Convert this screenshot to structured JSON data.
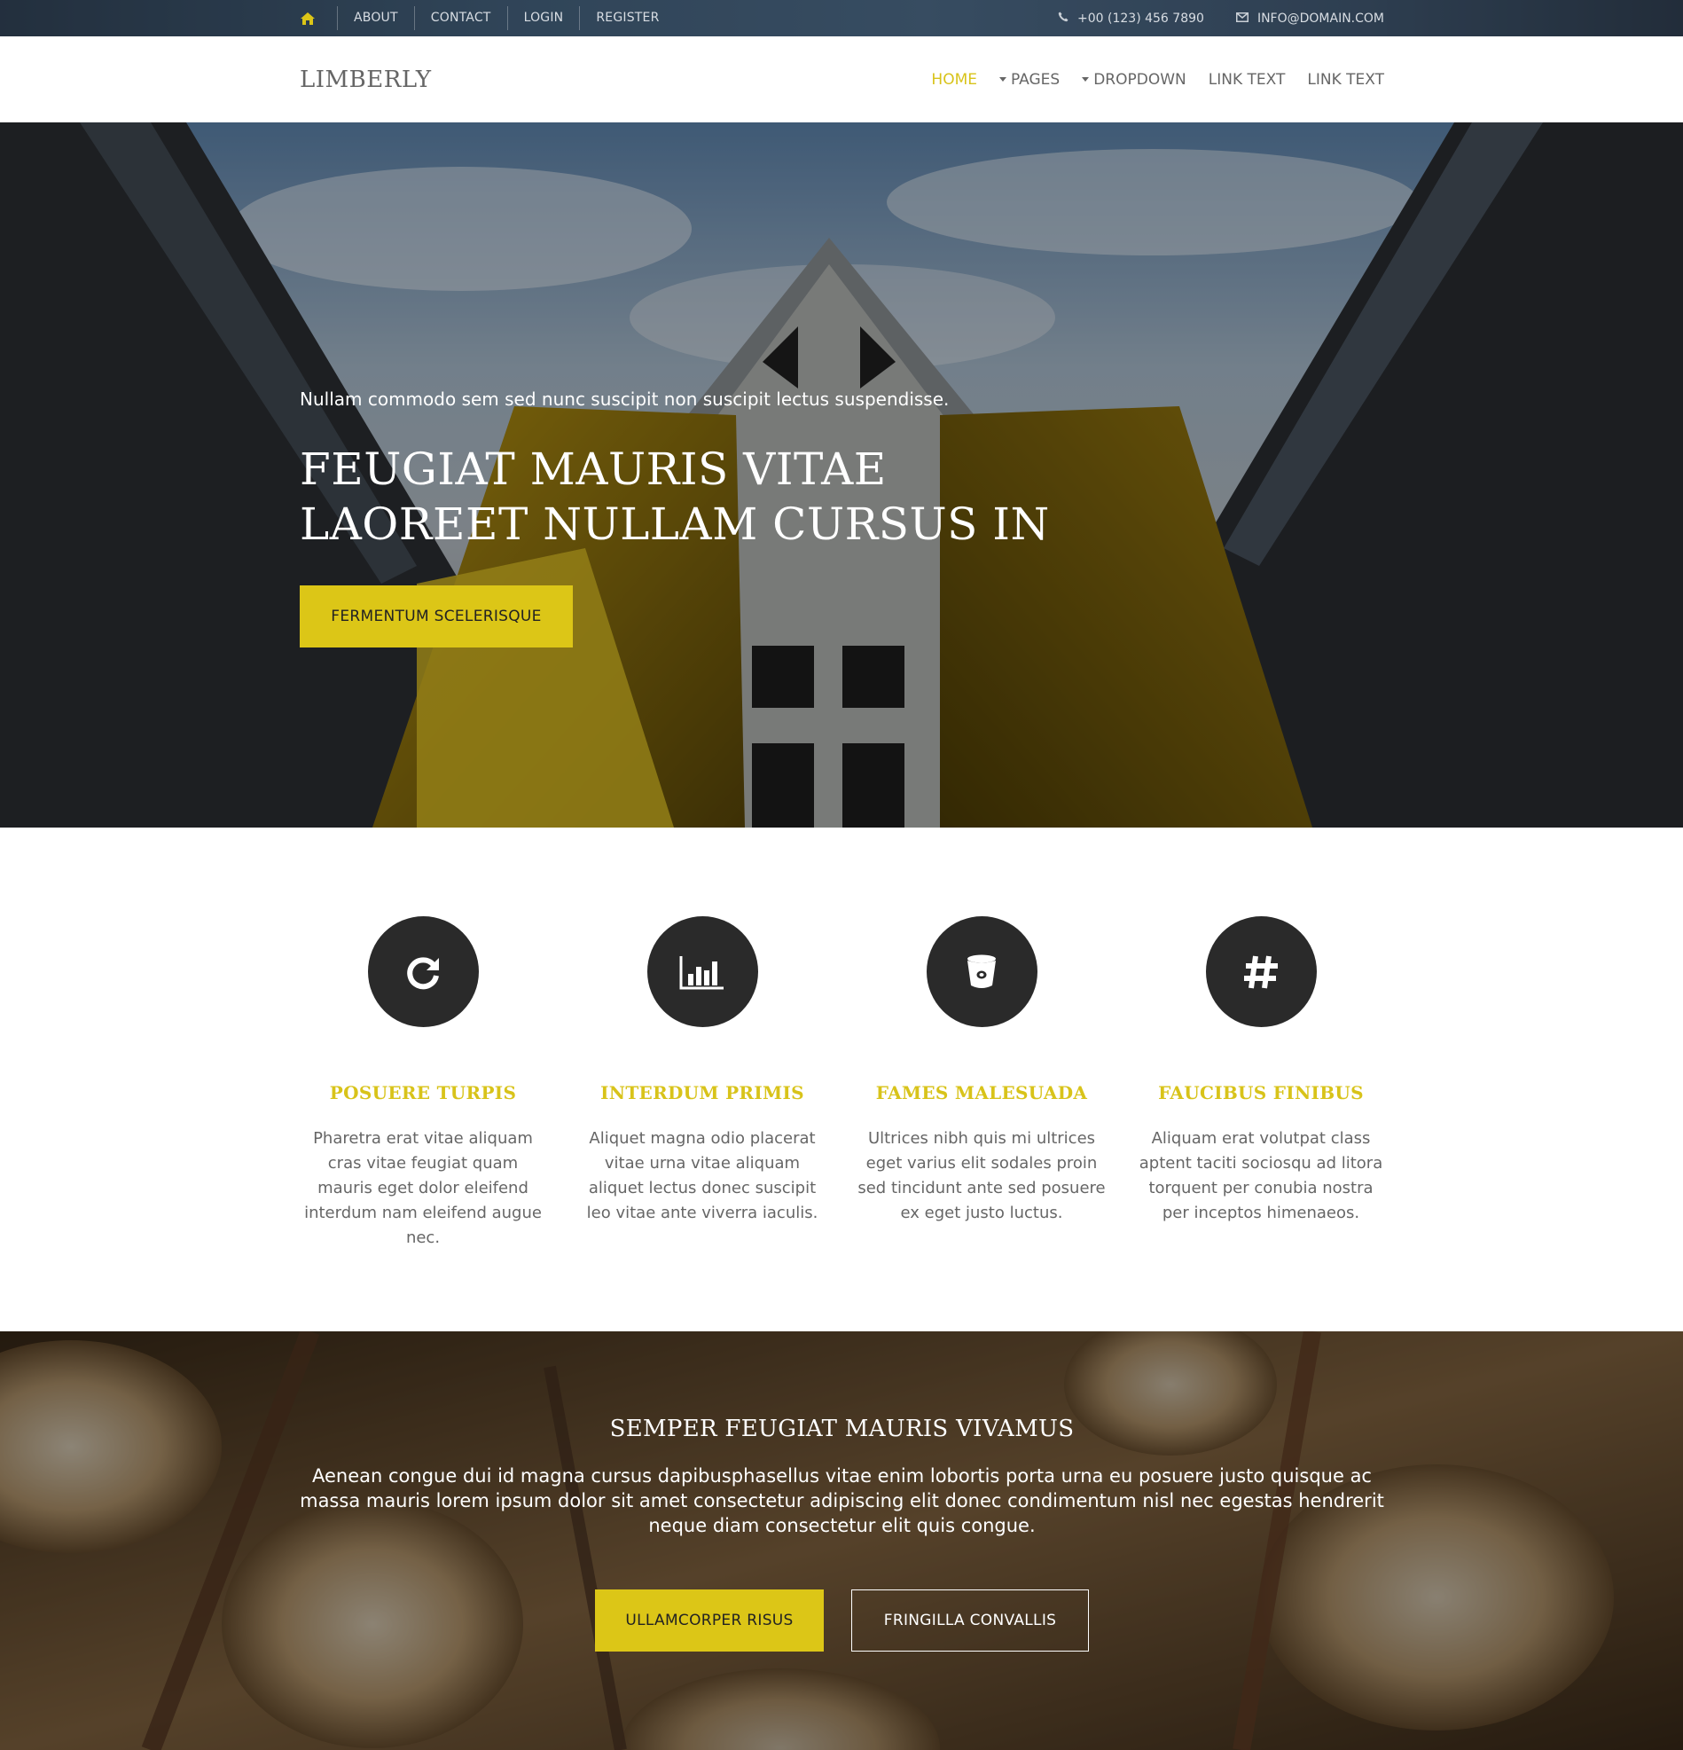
{
  "topbar": {
    "home_icon": "home-icon",
    "links": [
      "ABOUT",
      "CONTACT",
      "LOGIN",
      "REGISTER"
    ],
    "phone_icon": "phone-icon",
    "phone": "+00 (123) 456 7890",
    "email_icon": "envelope-icon",
    "email": "INFO@DOMAIN.COM"
  },
  "navbar": {
    "brand": "LIMBERLY",
    "items": [
      {
        "label": "HOME",
        "active": true,
        "dropdown": false
      },
      {
        "label": "PAGES",
        "active": false,
        "dropdown": true
      },
      {
        "label": "DROPDOWN",
        "active": false,
        "dropdown": true
      },
      {
        "label": "LINK TEXT",
        "active": false,
        "dropdown": false
      },
      {
        "label": "LINK TEXT",
        "active": false,
        "dropdown": false
      }
    ]
  },
  "hero": {
    "lead": "Nullam commodo sem sed nunc suscipit non suscipit lectus suspendisse.",
    "title": "FEUGIAT MAURIS VITAE LAOREET NULLAM CURSUS IN",
    "button": "FERMENTUM SCELERISQUE"
  },
  "features": [
    {
      "icon": "refresh-icon",
      "title": "POSUERE TURPIS",
      "text": "Pharetra erat vitae aliquam cras vitae feugiat quam mauris eget dolor eleifend interdum nam eleifend augue nec."
    },
    {
      "icon": "bar-chart-icon",
      "title": "INTERDUM PRIMIS",
      "text": "Aliquet magna odio placerat vitae urna vitae aliquam aliquet lectus donec suscipit leo vitae ante viverra iaculis."
    },
    {
      "icon": "bucket-icon",
      "title": "FAMES MALESUADA",
      "text": "Ultrices nibh quis mi ultrices eget varius elit sodales proin sed tincidunt ante sed posuere ex eget justo luctus."
    },
    {
      "icon": "hashtag-icon",
      "title": "FAUCIBUS FINIBUS",
      "text": "Aliquam erat volutpat class aptent taciti sociosqu ad litora torquent per conubia nostra per inceptos himenaeos."
    }
  ],
  "cta": {
    "title": "SEMPER FEUGIAT MAURIS VIVAMUS",
    "text": "Aenean congue dui id magna cursus dapibusphasellus vitae enim lobortis porta urna eu posuere justo quisque ac massa mauris lorem ipsum dolor sit amet consectetur adipiscing elit donec condimentum nisl nec egestas hendrerit neque diam consectetur elit quis congue.",
    "primary_button": "ULLAMCORPER RISUS",
    "secondary_button": "FRINGILLA CONVALLIS"
  },
  "colors": {
    "accent": "#dcc617",
    "dark_circle": "#2a2a2a",
    "text_grey": "#666666"
  }
}
